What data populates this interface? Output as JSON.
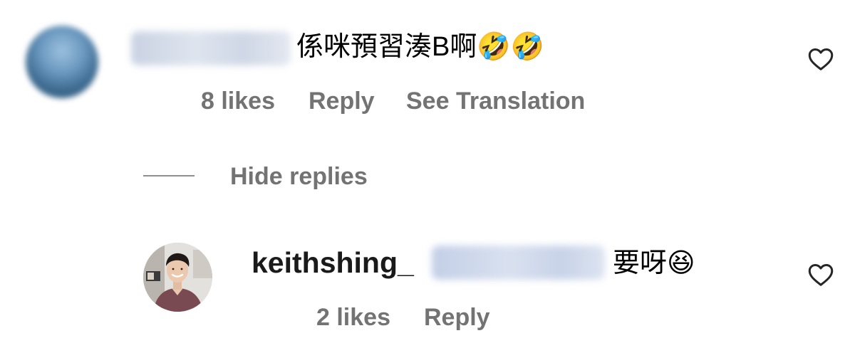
{
  "comment": {
    "text": "係咪預習湊B啊🤣🤣",
    "likes_label": "8 likes",
    "reply_label": "Reply",
    "translate_label": "See Translation"
  },
  "thread": {
    "hide_replies_label": "Hide replies"
  },
  "reply": {
    "username": "keithshing_",
    "text": "要呀😆",
    "likes_label": "2 likes",
    "reply_label": "Reply"
  },
  "icons": {
    "like": "heart-outline-icon"
  },
  "colors": {
    "meta_text": "#737373",
    "divider": "#8e8e8e",
    "text": "#000000"
  }
}
